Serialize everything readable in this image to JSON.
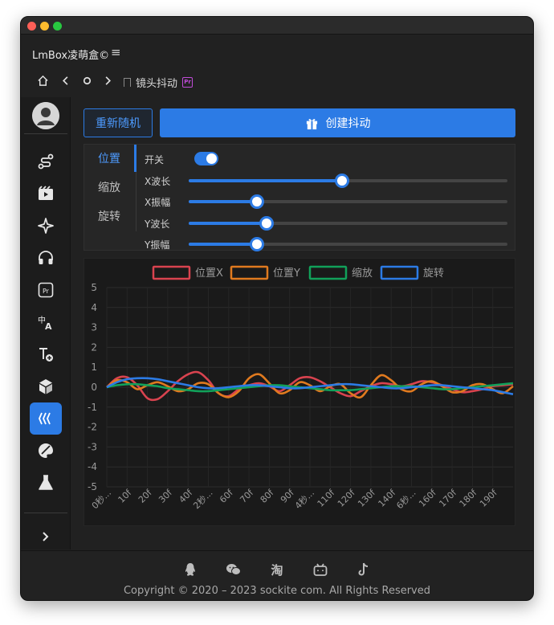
{
  "app": {
    "title": "LmBox凌萌盒©"
  },
  "nav": {
    "page_title": "镜头抖动",
    "badge": "Pr"
  },
  "toolbar": {
    "random_label": "重新随机",
    "create_label": "创建抖动"
  },
  "tabs": [
    "位置",
    "缩放",
    "旋转"
  ],
  "controls": {
    "switch_label": "开关",
    "switch_on": true,
    "sliders": [
      {
        "label": "X波长",
        "value": 0.48
      },
      {
        "label": "X振幅",
        "value": 0.215
      },
      {
        "label": "Y波长",
        "value": 0.245
      },
      {
        "label": "Y振幅",
        "value": 0.215
      }
    ]
  },
  "sidebar": {
    "icons": [
      "avatar",
      "route-icon",
      "clapperboard-icon",
      "sparkle-icon",
      "headphones-icon",
      "premiere-icon",
      "translate-icon",
      "add-layer-icon",
      "cube-icon",
      "shake-icon",
      "palette-icon",
      "flask-icon"
    ],
    "active": "shake-icon",
    "collapse_icon": "chevron-right-icon"
  },
  "colors": {
    "accent": "#2c7be5",
    "series_pos_x": "#d9434f",
    "series_pos_y": "#e07a1f",
    "series_scale": "#11a15a",
    "series_rotate": "#2c7be5"
  },
  "chart_data": {
    "type": "line",
    "ylim": [
      -5,
      5
    ],
    "yticks": [
      "5",
      "4",
      "3",
      "2",
      "1",
      "0",
      "-1",
      "-2",
      "-3",
      "-4",
      "-5"
    ],
    "x": [
      0,
      5,
      10,
      15,
      20,
      25,
      30,
      35,
      40,
      45,
      50,
      55,
      60,
      65,
      70,
      75,
      80,
      85,
      90,
      95,
      100,
      105,
      110,
      115,
      120,
      125,
      130,
      135,
      140,
      145,
      150,
      155,
      160,
      165,
      170,
      175,
      180,
      185,
      190,
      195,
      200
    ],
    "xticks": [
      "0秒...",
      "10f",
      "20f",
      "30f",
      "40f",
      "2秒...",
      "60f",
      "70f",
      "80f",
      "90f",
      "4秒...",
      "110f",
      "120f",
      "130f",
      "140f",
      "6秒...",
      "160f",
      "170f",
      "180f",
      "190f"
    ],
    "grid": true,
    "legend_position": "top",
    "series": [
      {
        "name": "位置X",
        "values": [
          0,
          0.45,
          0.5,
          0.1,
          -0.55,
          -0.6,
          -0.2,
          0.3,
          0.65,
          0.75,
          0.35,
          -0.3,
          -0.45,
          -0.1,
          0.1,
          0.2,
          0.05,
          -0.2,
          0.1,
          0.45,
          0.5,
          0.3,
          0,
          -0.3,
          -0.45,
          -0.2,
          0.05,
          0.2,
          0.15,
          0.05,
          0.15,
          0.3,
          0.25,
          0.1,
          -0.1,
          -0.25,
          -0.2,
          -0.1,
          0.05,
          0.1,
          0.15
        ]
      },
      {
        "name": "位置Y",
        "values": [
          0,
          0.35,
          0.25,
          -0.1,
          0.1,
          0.25,
          0.05,
          -0.2,
          -0.1,
          0.2,
          0.15,
          -0.3,
          -0.5,
          -0.2,
          0.45,
          0.65,
          0.2,
          -0.3,
          -0.15,
          0.25,
          0.1,
          -0.2,
          0.05,
          0.15,
          -0.3,
          -0.5,
          0.1,
          0.6,
          0.35,
          -0.1,
          -0.2,
          0.15,
          0.3,
          0.05,
          -0.25,
          -0.2,
          0.1,
          0.15,
          -0.1,
          -0.3,
          0.05
        ]
      },
      {
        "name": "缩放",
        "values": [
          0,
          0.1,
          0.15,
          0.15,
          0.1,
          0.05,
          -0.05,
          -0.1,
          -0.15,
          -0.2,
          -0.2,
          -0.15,
          -0.1,
          -0.05,
          0,
          0.05,
          0.1,
          0.1,
          0.05,
          0,
          -0.05,
          -0.1,
          -0.15,
          -0.15,
          -0.15,
          -0.1,
          -0.05,
          0,
          0.05,
          0.05,
          0.05,
          0,
          -0.05,
          -0.1,
          -0.1,
          -0.05,
          0,
          0.05,
          0.1,
          0.15,
          0.2
        ]
      },
      {
        "name": "旋转",
        "values": [
          0,
          0.25,
          0.4,
          0.45,
          0.45,
          0.4,
          0.3,
          0.2,
          0.1,
          0,
          -0.05,
          -0.05,
          0,
          0.05,
          0.1,
          0.1,
          0.05,
          0,
          -0.05,
          -0.05,
          0,
          0.05,
          0.1,
          0.15,
          0.15,
          0.1,
          0.05,
          0,
          -0.05,
          -0.05,
          0,
          0.05,
          0.1,
          0.1,
          0.05,
          0,
          -0.05,
          -0.1,
          -0.15,
          -0.25,
          -0.35
        ]
      }
    ]
  },
  "footer": {
    "icons": [
      "qq-icon",
      "wechat-icon",
      "taobao-icon",
      "bilibili-icon",
      "tiktok-icon"
    ],
    "copyright": "Copyright © 2020 – 2023 sockite com. All Rights Reserved"
  }
}
